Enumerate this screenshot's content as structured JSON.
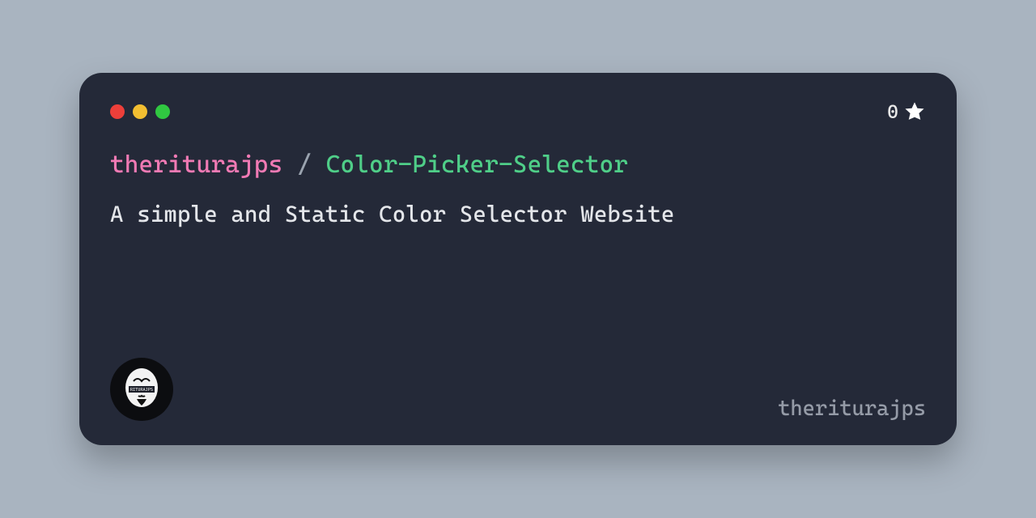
{
  "window": {
    "traffic_colors": {
      "red": "#ed3f3a",
      "yellow": "#f2be31",
      "green": "#30c841"
    }
  },
  "stars": {
    "count": "0"
  },
  "repo": {
    "owner": "theriturajps",
    "separator": "/",
    "name": "Color-Picker-Selector"
  },
  "description": "A simple and Static Color Selector Website",
  "footer": {
    "username": "theriturajps",
    "avatar_label": "RITURAJPS"
  },
  "colors": {
    "background": "#a9b4c0",
    "card": "#242938",
    "owner": "#f07ab4",
    "repo": "#4fce88",
    "text": "#e4e6ea",
    "muted": "#959ba7"
  }
}
